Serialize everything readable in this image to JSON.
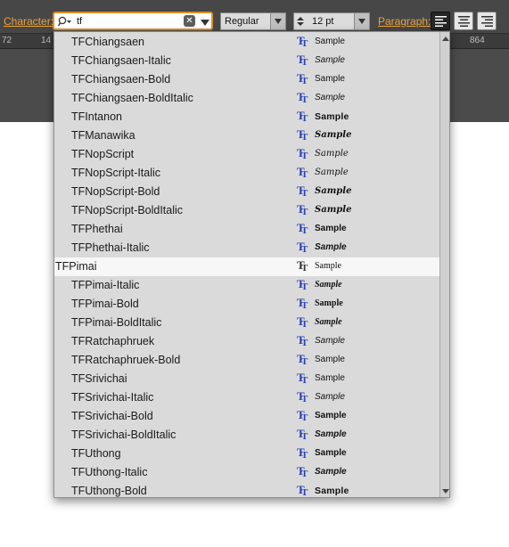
{
  "toolbar": {
    "character_label": "Character:",
    "paragraph_label": "Paragraph:",
    "search_value": "tf",
    "font_style": "Regular",
    "font_size": "12 pt",
    "accent_color": "#e8a33d"
  },
  "ruler": {
    "left_number": "72",
    "mid_number": "14",
    "right_number": "864"
  },
  "font_list": {
    "sample_text": "Sample",
    "items": [
      {
        "name": "TFChiangsaen",
        "sample_style": "regular"
      },
      {
        "name": "TFChiangsaen-Italic",
        "sample_style": "italic"
      },
      {
        "name": "TFChiangsaen-Bold",
        "sample_style": "regular"
      },
      {
        "name": "TFChiangsaen-BoldItalic",
        "sample_style": "italic"
      },
      {
        "name": "TFIntanon",
        "sample_style": "heavy"
      },
      {
        "name": "TFManawika",
        "sample_style": "script-bold"
      },
      {
        "name": "TFNopScript",
        "sample_style": "script"
      },
      {
        "name": "TFNopScript-Italic",
        "sample_style": "script"
      },
      {
        "name": "TFNopScript-Bold",
        "sample_style": "script-bold"
      },
      {
        "name": "TFNopScript-BoldItalic",
        "sample_style": "script-bold"
      },
      {
        "name": "TFPhethai",
        "sample_style": "bold"
      },
      {
        "name": "TFPhethai-Italic",
        "sample_style": "bold-italic"
      },
      {
        "name": "TFPimai",
        "sample_style": "serif",
        "selected": true
      },
      {
        "name": "TFPimai-Italic",
        "sample_style": "serif-bold-italic"
      },
      {
        "name": "TFPimai-Bold",
        "sample_style": "serif-bold"
      },
      {
        "name": "TFPimai-BoldItalic",
        "sample_style": "serif-bold-italic"
      },
      {
        "name": "TFRatchaphruek",
        "sample_style": "italic"
      },
      {
        "name": "TFRatchaphruek-Bold",
        "sample_style": "regular"
      },
      {
        "name": "TFSrivichai",
        "sample_style": "regular"
      },
      {
        "name": "TFSrivichai-Italic",
        "sample_style": "italic"
      },
      {
        "name": "TFSrivichai-Bold",
        "sample_style": "bold"
      },
      {
        "name": "TFSrivichai-BoldItalic",
        "sample_style": "bold-italic"
      },
      {
        "name": "TFUthong",
        "sample_style": "bold"
      },
      {
        "name": "TFUthong-Italic",
        "sample_style": "bold-italic"
      },
      {
        "name": "TFUthong-Bold",
        "sample_style": "heavy"
      }
    ]
  }
}
